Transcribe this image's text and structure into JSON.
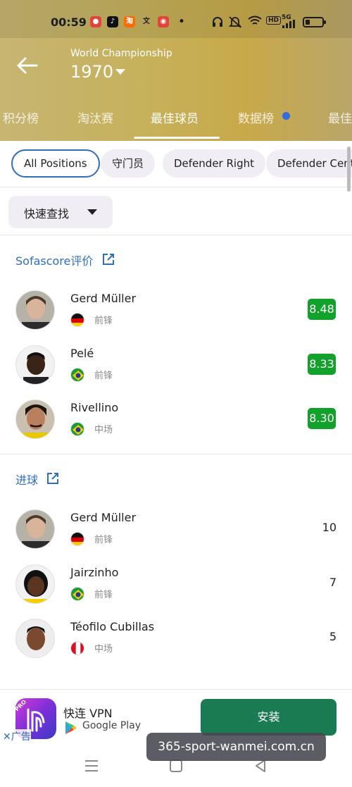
{
  "status_bar": {
    "time": "00:59",
    "hd_label": "HD",
    "signal_label": "5G"
  },
  "header": {
    "competition": "World Championship",
    "season": "1970"
  },
  "tabs": [
    {
      "label": "积分榜",
      "active": false
    },
    {
      "label": "淘汰赛",
      "active": false
    },
    {
      "label": "最佳球员",
      "active": true
    },
    {
      "label": "数据榜",
      "active": false,
      "has_dot": true
    },
    {
      "label": "最佳",
      "active": false
    }
  ],
  "position_filters": [
    {
      "label": "All Positions",
      "active": true
    },
    {
      "label": "守门员",
      "active": false
    },
    {
      "label": "Defender Right",
      "active": false
    },
    {
      "label": "Defender Center",
      "active": false
    }
  ],
  "quick_find": {
    "label": "快速查找"
  },
  "sections": [
    {
      "title": "Sofascore评价",
      "players": [
        {
          "name": "Gerd Müller",
          "country": "Germany",
          "position": "前锋",
          "value": "8.48"
        },
        {
          "name": "Pelé",
          "country": "Brazil",
          "position": "前锋",
          "value": "8.33"
        },
        {
          "name": "Rivellino",
          "country": "Brazil",
          "position": "中场",
          "value": "8.30"
        }
      ]
    },
    {
      "title": "进球",
      "players": [
        {
          "name": "Gerd Müller",
          "country": "Germany",
          "position": "前锋",
          "value": "10"
        },
        {
          "name": "Jairzinho",
          "country": "Brazil",
          "position": "前锋",
          "value": "7"
        },
        {
          "name": "Téofilo Cubillas",
          "country": "Peru",
          "position": "中场",
          "value": "5"
        }
      ]
    }
  ],
  "ad": {
    "title": "快连 VPN",
    "store": "Google Play",
    "install_label": "安装",
    "ad_label": "广告",
    "logo_text": "PRO"
  },
  "watermark": "365-sport-wanmei.com.cn",
  "colors": {
    "header_gold": "#c6b15c",
    "accent_blue": "#2f6fc0",
    "rating_green": "#12a12a",
    "install_green": "#1a7a52"
  }
}
